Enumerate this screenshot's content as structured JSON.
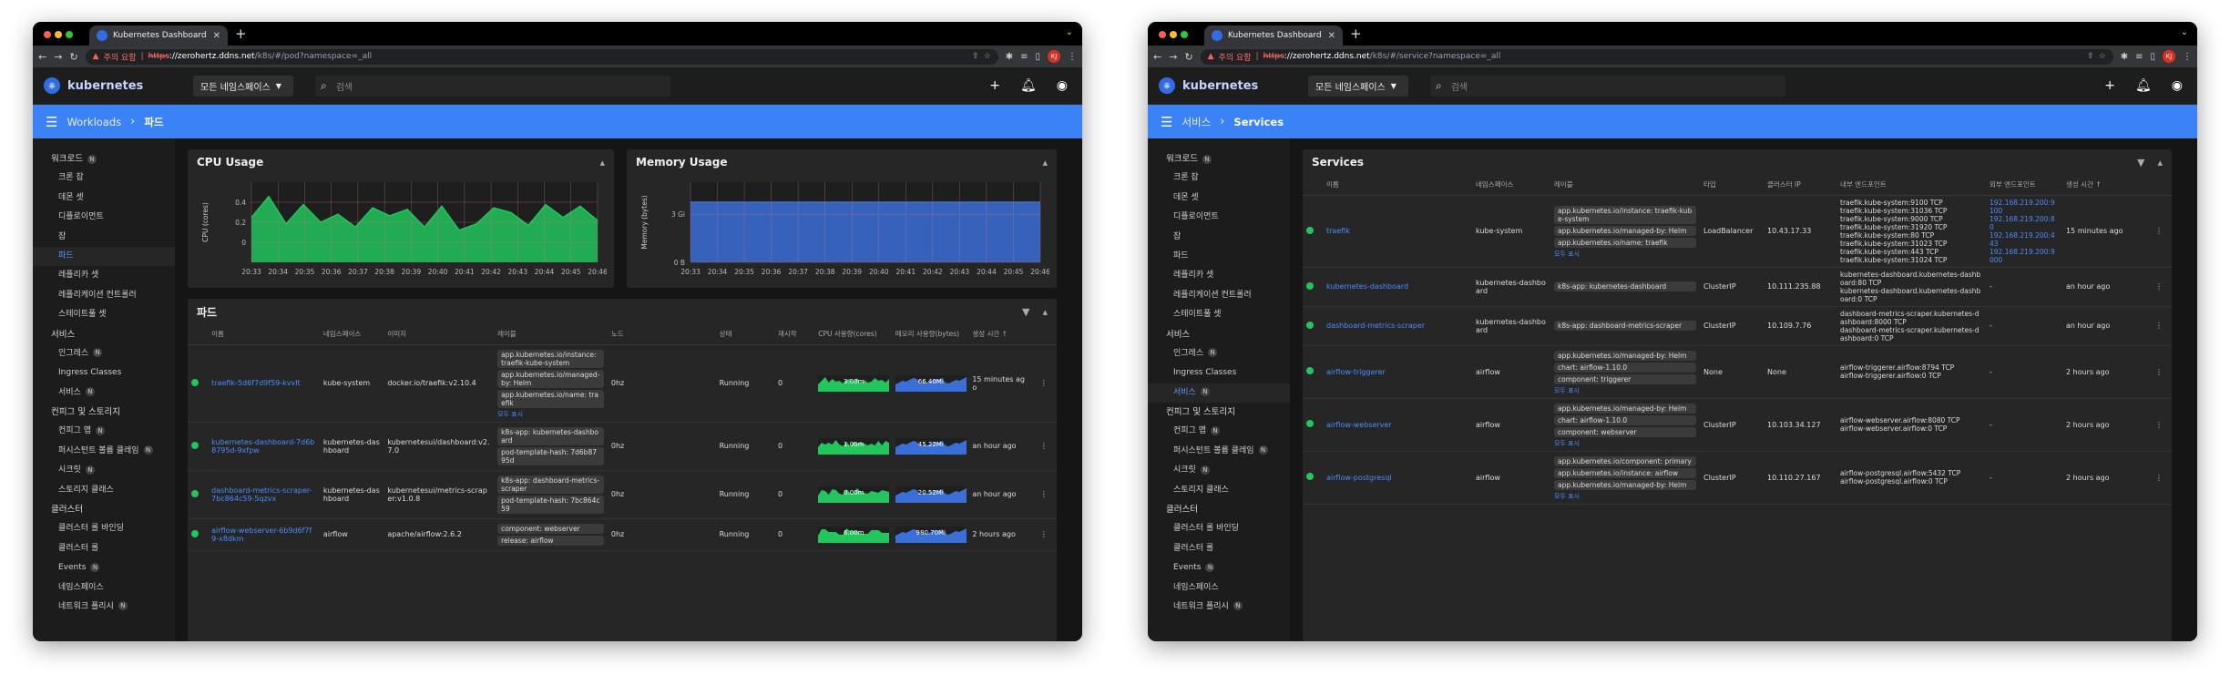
{
  "browser": {
    "tab_title": "Kubernetes Dashboard",
    "warning": "주의 요함",
    "scheme": "https",
    "host": "://zerohertz.ddns.net",
    "profile": "KJ",
    "colors": {
      "red": "#ff5f57",
      "yellow": "#febc2e",
      "green": "#28c840"
    }
  },
  "url": {
    "left": "/k8s/#/pod?namespace=_all",
    "right": "/k8s/#/service?namespace=_all"
  },
  "header": {
    "brand": "kubernetes",
    "namespace": "모든 네임스페이스",
    "search_placeholder": "검색"
  },
  "breadcrumb": {
    "left": {
      "parent": "Workloads",
      "current": "파드"
    },
    "right": {
      "parent": "서비스",
      "current": "Services"
    }
  },
  "sidebar": {
    "sections": [
      {
        "title": "워크로드",
        "badge": "N",
        "items": [
          {
            "label": "크론 잡"
          },
          {
            "label": "데몬 셋"
          },
          {
            "label": "디플로이먼트"
          },
          {
            "label": "잡"
          },
          {
            "label": "파드"
          },
          {
            "label": "레플리카 셋"
          },
          {
            "label": "레플리케이션 컨트롤러"
          },
          {
            "label": "스테이트풀 셋"
          }
        ]
      },
      {
        "title": "서비스",
        "items": [
          {
            "label": "인그레스",
            "badge": "N"
          },
          {
            "label": "Ingress Classes"
          },
          {
            "label": "서비스",
            "badge": "N"
          }
        ]
      },
      {
        "title": "컨피그 및 스토리지",
        "items": [
          {
            "label": "컨피그 맵",
            "badge": "N"
          },
          {
            "label": "퍼시스턴트 볼륨 클레임",
            "badge": "N"
          },
          {
            "label": "시크릿",
            "badge": "N"
          },
          {
            "label": "스토리지 클래스"
          }
        ]
      },
      {
        "title": "클러스터",
        "items": [
          {
            "label": "클러스터 롤 바인딩"
          },
          {
            "label": "클러스터 롤"
          },
          {
            "label": "Events",
            "badge": "N"
          },
          {
            "label": "네임스페이스"
          },
          {
            "label": "네트워크 폴리시",
            "badge": "N"
          }
        ]
      }
    ]
  },
  "charts": {
    "cpu": {
      "title": "CPU Usage"
    },
    "memory": {
      "title": "Memory Usage"
    }
  },
  "chart_data": [
    {
      "type": "area",
      "title": "CPU Usage",
      "ylabel": "CPU (cores)",
      "x": [
        "20:33",
        "20:34",
        "20:35",
        "20:36",
        "20:37",
        "20:38",
        "20:39",
        "20:40",
        "20:41",
        "20:42",
        "20:43",
        "20:44",
        "20:45",
        "20:46"
      ],
      "yticks": [
        "0.4",
        "0.2",
        "0"
      ],
      "series": [
        {
          "values": [
            0.28,
            0.41,
            0.24,
            0.36,
            0.25,
            0.3,
            0.22,
            0.34,
            0.29,
            0.33,
            0.22,
            0.35,
            0.2,
            0.24,
            0.34,
            0.31,
            0.23,
            0.36,
            0.28,
            0.35,
            0.26
          ]
        }
      ],
      "ylim": [
        0,
        0.5
      ],
      "color": "#22c55e"
    },
    {
      "type": "area",
      "title": "Memory Usage",
      "ylabel": "Memory (bytes)",
      "x": [
        "20:33",
        "20:34",
        "20:35",
        "20:36",
        "20:37",
        "20:38",
        "20:39",
        "20:40",
        "20:41",
        "20:42",
        "20:43",
        "20:44",
        "20:45",
        "20:46"
      ],
      "yticks": [
        "3 Gi",
        "0 B"
      ],
      "series": [
        {
          "values": [
            3.75,
            3.75,
            3.75,
            3.75,
            3.75,
            3.75,
            3.75,
            3.75,
            3.75,
            3.75,
            3.75,
            3.75,
            3.75,
            3.75
          ]
        }
      ],
      "ylim": [
        0,
        5
      ],
      "color": "#3b6fd8"
    }
  ],
  "pods": {
    "title": "파드",
    "columns": [
      "이름",
      "네임스페이스",
      "이미지",
      "레이블",
      "노드",
      "상태",
      "재시작",
      "CPU 사용량(cores)",
      "메모리 사용량(bytes)",
      "생성 시간 ↑"
    ],
    "rows": [
      {
        "name": "traefik-5d6f7d9f59-kvvlt",
        "namespace": "kube-system",
        "image": "docker.io/traefik:v2.10.4",
        "labels": [
          "app.kubernetes.io/instance: traefik-kube-system",
          "app.kubernetes.io/managed-by: Helm",
          "app.kubernetes.io/name: traefik"
        ],
        "more": "모두 표시",
        "node": "0hz",
        "status": "Running",
        "restarts": "0",
        "cpu": "3.00m",
        "mem": "66.40Mi",
        "age": "15 minutes ago"
      },
      {
        "name": "kubernetes-dashboard-7d6b8795d-9xfpw",
        "namespace": "kubernetes-dashboard",
        "image": "kubernetesui/dashboard:v2.7.0",
        "labels": [
          "k8s-app: kubernetes-dashboard",
          "pod-template-hash: 7d6b8795d"
        ],
        "more": "",
        "node": "0hz",
        "status": "Running",
        "restarts": "0",
        "cpu": "1.00m",
        "mem": "45.22Mi",
        "age": "an hour ago"
      },
      {
        "name": "dashboard-metrics-scraper-7bc864c59-5qzvx",
        "namespace": "kubernetes-dashboard",
        "image": "kubernetesui/metrics-scraper:v1.0.8",
        "labels": [
          "k8s-app: dashboard-metrics-scraper",
          "pod-template-hash: 7bc864c59"
        ],
        "more": "",
        "node": "0hz",
        "status": "Running",
        "restarts": "0",
        "cpu": "0.00m",
        "mem": "20.52Mi",
        "age": "an hour ago"
      },
      {
        "name": "airflow-webserver-6b9d6f7f9-x8dkm",
        "namespace": "airflow",
        "image": "apache/airflow:2.6.2",
        "labels": [
          "component: webserver",
          "release: airflow"
        ],
        "more": "",
        "node": "0hz",
        "status": "Running",
        "restarts": "0",
        "cpu": "6.00m",
        "mem": "980.70Mi",
        "age": "2 hours ago"
      }
    ]
  },
  "services": {
    "title": "Services",
    "columns": [
      "이름",
      "네임스페이스",
      "레이블",
      "타입",
      "클러스터 IP",
      "내부 엔드포인트",
      "외부 엔드포인트",
      "생성 시간 ↑"
    ],
    "rows": [
      {
        "name": "traefik",
        "namespace": "kube-system",
        "labels": [
          "app.kubernetes.io/instance: traefik-kube-system",
          "app.kubernetes.io/managed-by: Helm",
          "app.kubernetes.io/name: traefik"
        ],
        "more": "모두 표시",
        "type": "LoadBalancer",
        "ip": "10.43.17.33",
        "internal": [
          "traefik.kube-system:9100 TCP",
          "traefik.kube-system:31036 TCP",
          "traefik.kube-system:9000 TCP",
          "traefik.kube-system:31920 TCP",
          "traefik.kube-system:80 TCP",
          "traefik.kube-system:31023 TCP",
          "traefik.kube-system:443 TCP",
          "traefik.kube-system:31024 TCP"
        ],
        "external": [
          "192.168.219.200:9100",
          "192.168.219.200:80",
          "192.168.219.200:443",
          "192.168.219.200:9000"
        ],
        "age": "15 minutes ago"
      },
      {
        "name": "kubernetes-dashboard",
        "namespace": "kubernetes-dashboard",
        "labels": [
          "k8s-app: kubernetes-dashboard"
        ],
        "more": "",
        "type": "ClusterIP",
        "ip": "10.111.235.88",
        "internal": [
          "kubernetes-dashboard.kubernetes-dashboard:80 TCP",
          "kubernetes-dashboard.kubernetes-dashboard:0 TCP"
        ],
        "external": [
          "-"
        ],
        "age": "an hour ago"
      },
      {
        "name": "dashboard-metrics-scraper",
        "namespace": "kubernetes-dashboard",
        "labels": [
          "k8s-app: dashboard-metrics-scraper"
        ],
        "more": "",
        "type": "ClusterIP",
        "ip": "10.109.7.76",
        "internal": [
          "dashboard-metrics-scraper.kubernetes-dashboard:8000 TCP",
          "dashboard-metrics-scraper.kubernetes-dashboard:0 TCP"
        ],
        "external": [
          "-"
        ],
        "age": "an hour ago"
      },
      {
        "name": "airflow-triggerer",
        "namespace": "airflow",
        "labels": [
          "app.kubernetes.io/managed-by: Helm",
          "chart: airflow-1.10.0",
          "component: triggerer"
        ],
        "more": "모두 표시",
        "type": "None",
        "ip": "None",
        "internal": [
          "airflow-triggerer.airflow:8794 TCP",
          "airflow-triggerer.airflow:0 TCP"
        ],
        "external": [
          "-"
        ],
        "age": "2 hours ago"
      },
      {
        "name": "airflow-webserver",
        "namespace": "airflow",
        "labels": [
          "app.kubernetes.io/managed-by: Helm",
          "chart: airflow-1.10.0",
          "component: webserver"
        ],
        "more": "모두 표시",
        "type": "ClusterIP",
        "ip": "10.103.34.127",
        "internal": [
          "airflow-webserver.airflow:8080 TCP",
          "airflow-webserver.airflow:0 TCP"
        ],
        "external": [
          "-"
        ],
        "age": "2 hours ago"
      },
      {
        "name": "airflow-postgresql",
        "namespace": "airflow",
        "labels": [
          "app.kubernetes.io/component: primary",
          "app.kubernetes.io/instance: airflow",
          "app.kubernetes.io/managed-by: Helm"
        ],
        "more": "모두 표시",
        "type": "ClusterIP",
        "ip": "10.110.27.167",
        "internal": [
          "airflow-postgresql.airflow:5432 TCP",
          "airflow-postgresql.airflow:0 TCP"
        ],
        "external": [
          "-"
        ],
        "age": "2 hours ago"
      }
    ]
  }
}
